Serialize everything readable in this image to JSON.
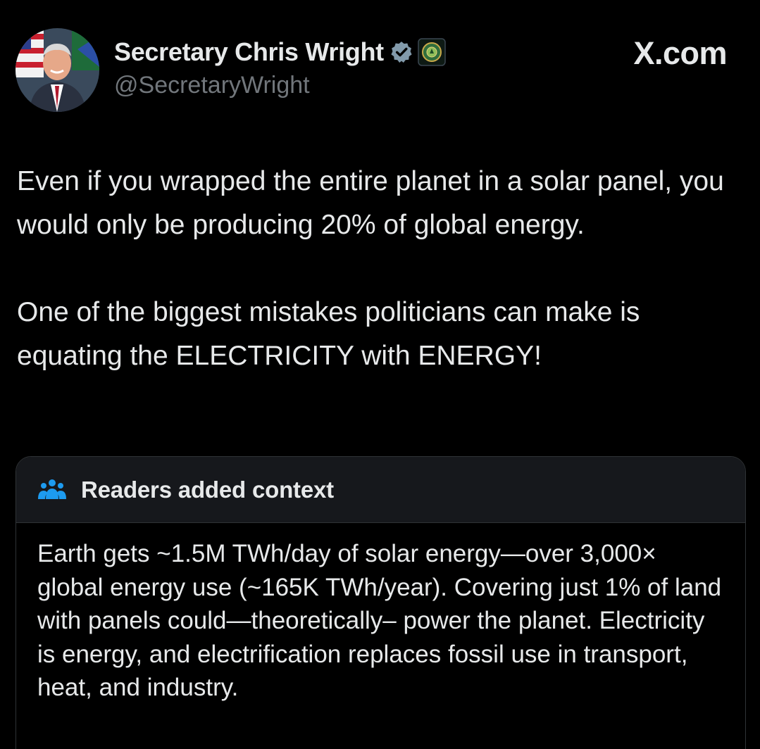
{
  "author": {
    "display_name": "Secretary Chris Wright",
    "handle": "@SecretaryWright",
    "verified_icon": "verified-badge-icon",
    "affiliate_icon": "doe-seal-icon"
  },
  "site_label": "X.com",
  "tweet": {
    "paragraphs": [
      "Even if you wrapped the entire planet in a solar panel, you would only be producing 20% of global energy.",
      "One of the biggest mistakes politicians can make is equating the ELECTRICITY with ENERGY!"
    ]
  },
  "community_note": {
    "title": "Readers added context",
    "icon": "readers-icon",
    "body": "Earth gets ~1.5M TWh/day of solar energy—over 3,000× global energy use (~165K TWh/year). Covering just 1% of land with panels could—theoretically– power the planet. Electricity is energy, and electrification replaces fossil use in transport, heat, and industry."
  },
  "colors": {
    "background": "#000000",
    "text": "#e7e9ea",
    "secondary_text": "#71767b",
    "note_header_bg": "#16181c",
    "border": "#2f3336",
    "readers_icon": "#1d9bf0"
  }
}
